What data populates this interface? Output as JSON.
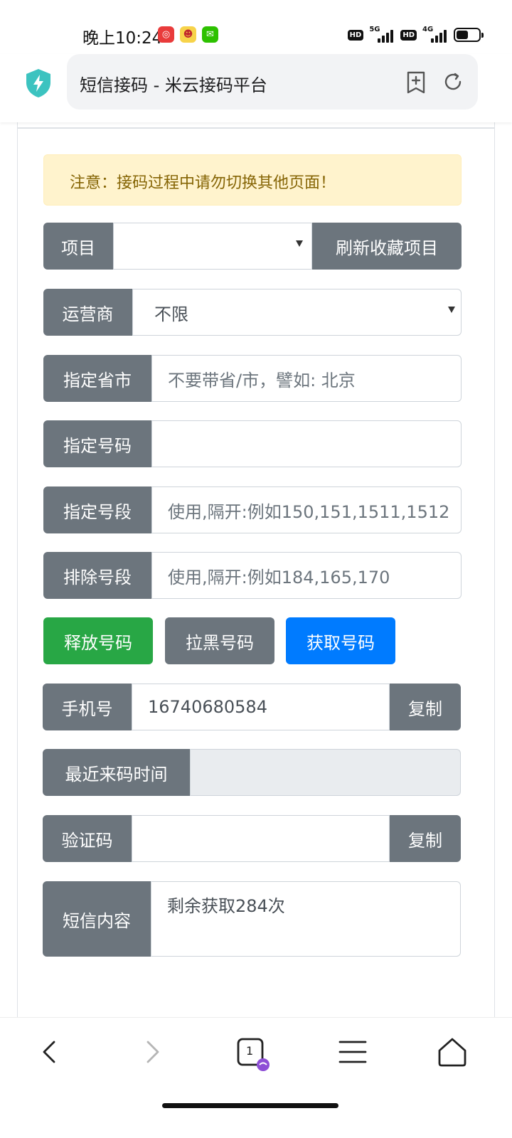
{
  "status_bar": {
    "time": "晚上10:24",
    "network_1": "5G",
    "network_2": "4G",
    "hd_label": "HD"
  },
  "browser": {
    "page_title": "短信接码 - 米云接码平台"
  },
  "alert": {
    "text": "注意：接码过程中请勿切换其他页面！"
  },
  "form": {
    "project_label": "项目",
    "project_value": "",
    "refresh_favorites_button": "刷新收藏项目",
    "operator_label": "运营商",
    "operator_value": "不限",
    "province_label": "指定省市",
    "province_placeholder": "不要带省/市，譬如: 北京",
    "number_label": "指定号码",
    "number_value": "",
    "segment_label": "指定号段",
    "segment_placeholder": "使用,隔开:例如150,151,1511,1512",
    "exclude_label": "排除号段",
    "exclude_placeholder": "使用,隔开:例如184,165,170",
    "release_button": "释放号码",
    "blacklist_button": "拉黑号码",
    "get_button": "获取号码",
    "phone_label": "手机号",
    "phone_value": "16740680584",
    "copy_phone_button": "复制",
    "last_code_time_label": "最近来码时间",
    "last_code_time_value": "",
    "code_label": "验证码",
    "code_value": "",
    "copy_code_button": "复制",
    "sms_label": "短信内容",
    "sms_value": "剩余获取284次"
  },
  "bottom_nav": {
    "tab_count": "1"
  },
  "colors": {
    "secondary": "#6c757d",
    "success": "#28a745",
    "primary": "#007bff",
    "alert_bg": "#fff3cd",
    "alert_text": "#856404",
    "shield": "#3cc3c0"
  }
}
